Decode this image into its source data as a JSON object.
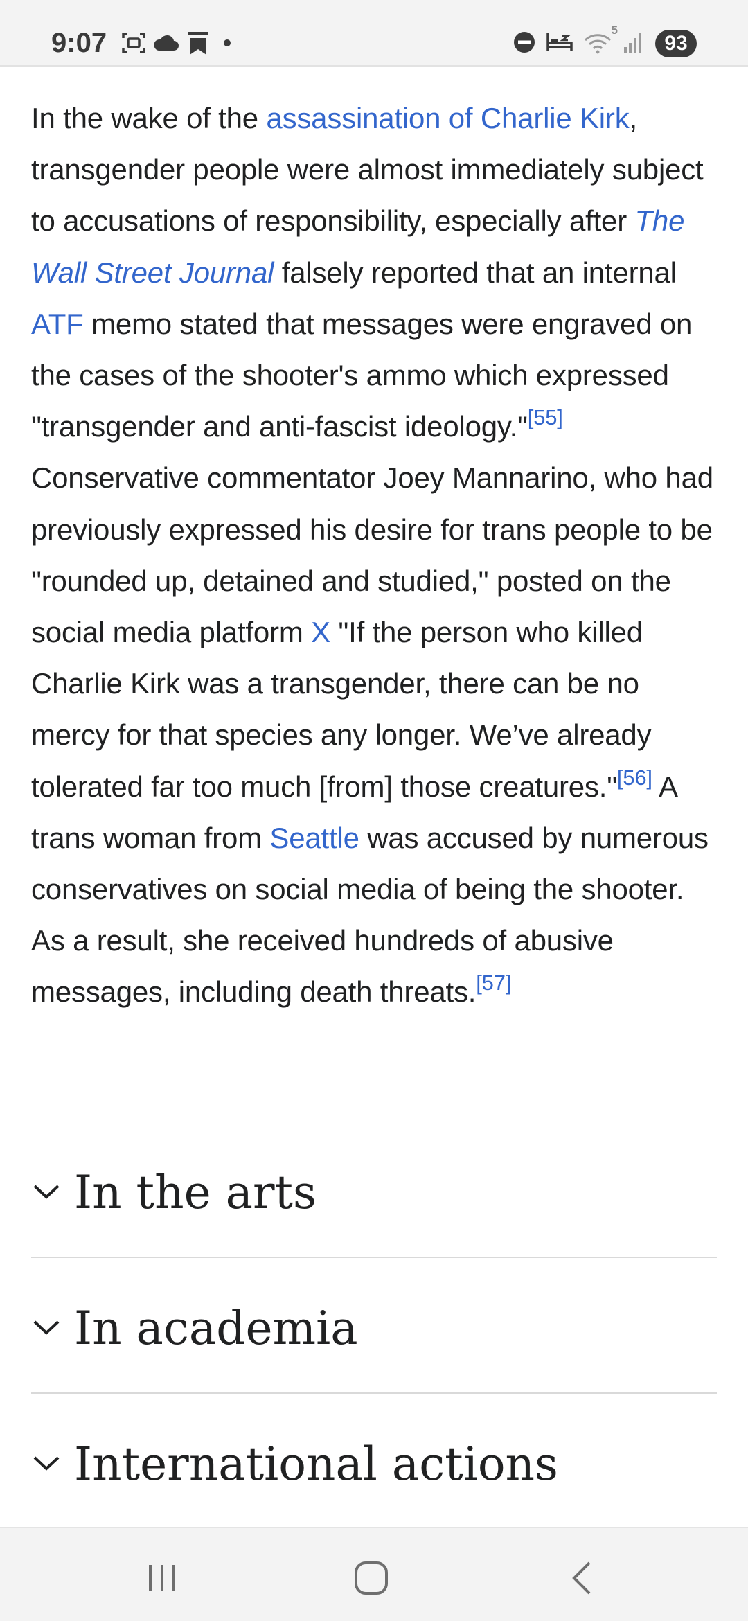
{
  "status_bar": {
    "time": "9:07",
    "left_icons": [
      "screenshot-icon",
      "cloud-icon",
      "bookmark-icon",
      "dot-icon"
    ],
    "right_icons": [
      "do-not-disturb-icon",
      "sleep-mode-icon",
      "wifi-icon",
      "signal-icon"
    ],
    "wifi_label": "5",
    "battery": "93"
  },
  "article": {
    "parts": {
      "t1": "In the wake of the ",
      "link_assassination": "assassination of Charlie Kirk",
      "t2": ", transgender people were almost immediately subject to accusations of responsibility, especially after ",
      "link_wsj": "The Wall Street Journal",
      "t3": " falsely reported that an internal ",
      "link_atf": "ATF",
      "t4": " memo stated that messages were engraved on the cases of the shooter's ammo which expressed \"transgender and anti-fascist ideology.\"",
      "ref_55": "[55]",
      "t5": " Conservative commentator Joey Mannarino, who had previously expressed his desire for trans people to be \"rounded up, detained and studied,\" posted on the social media platform ",
      "link_x": "X",
      "t6": " \"If the person who killed Charlie Kirk was a transgender, there can be no mercy for that species any longer. We’ve already tolerated far too much [from] those creatures.\"",
      "ref_56": "[56]",
      "t7": " A trans woman from ",
      "link_seattle": "Seattle",
      "t8": " was accused by numerous conservatives on social media of being the shooter. As a result, she received hundreds of abusive messages, including death threats.",
      "ref_57": "[57]"
    }
  },
  "sections": [
    {
      "title": "In the arts"
    },
    {
      "title": "In academia"
    },
    {
      "title": "International actions"
    }
  ],
  "nav_bar": {
    "buttons": [
      "recent-apps-icon",
      "home-icon",
      "back-icon"
    ]
  },
  "colors": {
    "link": "#3366cc",
    "text": "#202122",
    "bar_background": "#f3f3f3"
  }
}
